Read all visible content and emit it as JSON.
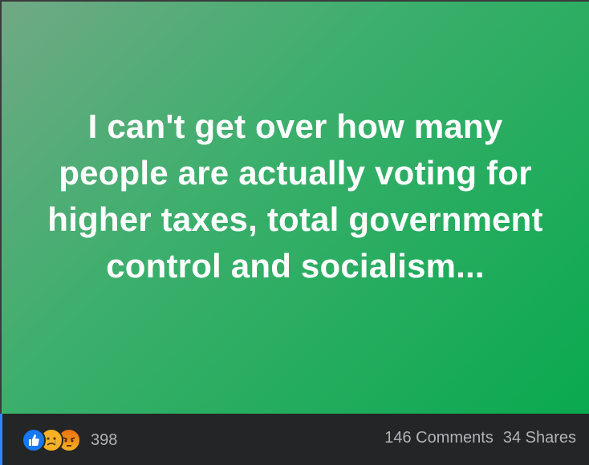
{
  "post": {
    "status_text": "I can't get over how many people are actually voting for higher taxes, total government control and socialism...",
    "background_gradient": [
      "#70a985",
      "#0aa94f"
    ]
  },
  "footer": {
    "reactions": [
      {
        "icon": "like-reaction-icon",
        "color": "#1877f2"
      },
      {
        "icon": "sad-reaction-icon",
        "color": "#f7b125"
      },
      {
        "icon": "angry-reaction-icon",
        "color": "#e9710f"
      }
    ],
    "reaction_count": "398",
    "comments_label": "146 Comments",
    "shares_label": "34 Shares"
  }
}
